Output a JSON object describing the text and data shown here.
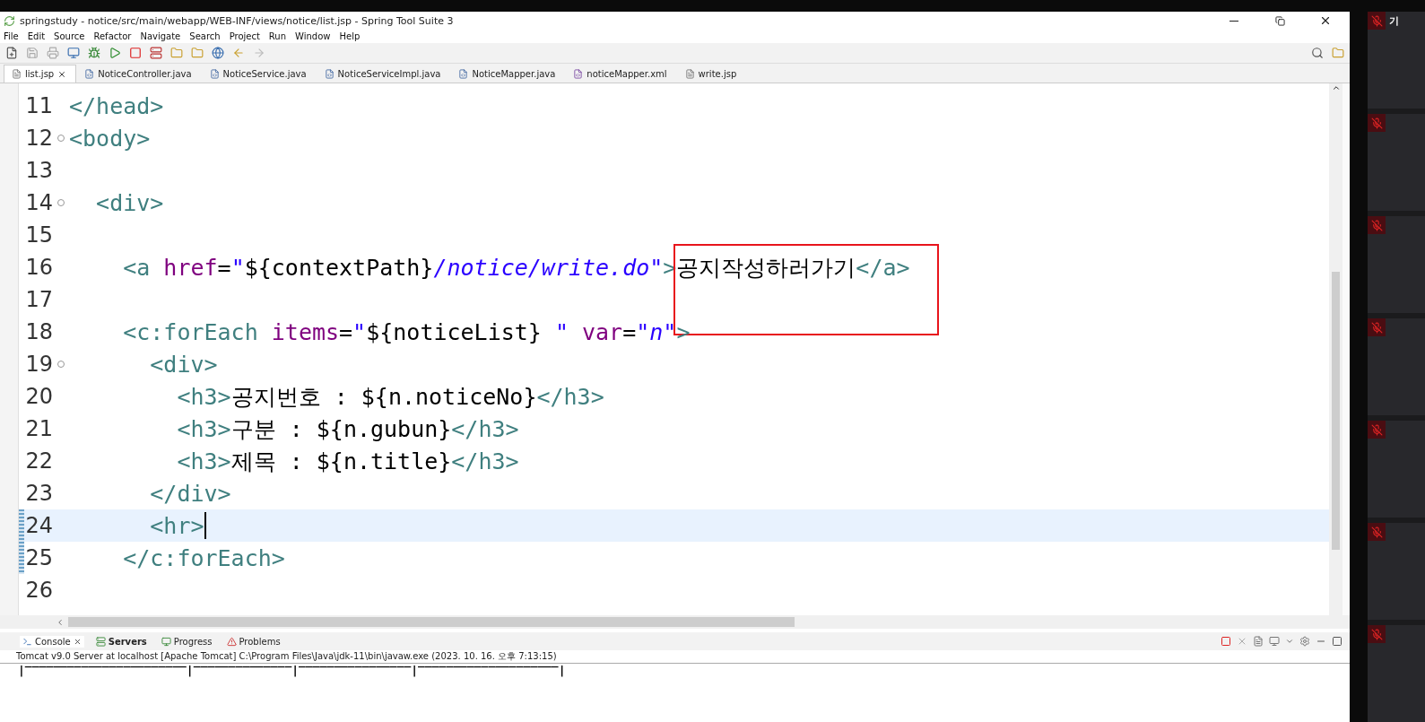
{
  "window": {
    "title": "springstudy - notice/src/main/webapp/WEB-INF/views/notice/list.jsp - Spring Tool Suite 3"
  },
  "menu": [
    "File",
    "Edit",
    "Source",
    "Refactor",
    "Navigate",
    "Search",
    "Project",
    "Run",
    "Window",
    "Help"
  ],
  "editor_tabs": [
    {
      "label": "list.jsp",
      "selected": true,
      "kind": "jsp"
    },
    {
      "label": "NoticeController.java",
      "selected": false,
      "kind": "java"
    },
    {
      "label": "NoticeService.java",
      "selected": false,
      "kind": "java"
    },
    {
      "label": "NoticeServiceImpl.java",
      "selected": false,
      "kind": "java"
    },
    {
      "label": "NoticeMapper.java",
      "selected": false,
      "kind": "java"
    },
    {
      "label": "noticeMapper.xml",
      "selected": false,
      "kind": "xml"
    },
    {
      "label": "write.jsp",
      "selected": false,
      "kind": "jsp"
    }
  ],
  "code_lines": [
    {
      "number": "11",
      "fold": false,
      "current": false,
      "changed": false,
      "tokens": [
        {
          "kind": "tag",
          "text": "</head>"
        }
      ]
    },
    {
      "number": "12",
      "fold": true,
      "current": false,
      "changed": false,
      "tokens": [
        {
          "kind": "tag",
          "text": "<body>"
        }
      ]
    },
    {
      "number": "13",
      "fold": false,
      "current": false,
      "changed": false
    },
    {
      "number": "14",
      "fold": true,
      "current": false,
      "changed": false,
      "tokens": [
        {
          "kind": "tag",
          "text": "  <div>"
        }
      ]
    },
    {
      "number": "15",
      "fold": false,
      "current": false,
      "changed": false
    },
    {
      "number": "16",
      "fold": false,
      "current": false,
      "changed": false,
      "tokens": [
        {
          "kind": "tag",
          "text": "    <a "
        },
        {
          "kind": "attr",
          "text": "href"
        },
        {
          "kind": "plain",
          "text": "="
        },
        {
          "kind": "string",
          "text": "\""
        },
        {
          "kind": "plain",
          "text": "${contextPath}"
        },
        {
          "kind": "string",
          "text": "/notice/write.do\""
        },
        {
          "kind": "tag",
          "text": ">"
        },
        {
          "kind": "boxed",
          "text": "공지작성하러가기"
        },
        {
          "kind": "tag",
          "text": "</a>"
        }
      ]
    },
    {
      "number": "17",
      "fold": false,
      "current": false,
      "changed": false
    },
    {
      "number": "18",
      "fold": false,
      "current": false,
      "changed": false,
      "tokens": [
        {
          "kind": "tag",
          "text": "    <c:forEach "
        },
        {
          "kind": "attr",
          "text": "items"
        },
        {
          "kind": "plain",
          "text": "="
        },
        {
          "kind": "string",
          "text": "\""
        },
        {
          "kind": "plain",
          "text": "${noticeList}"
        },
        {
          "kind": "string",
          "text": " \""
        },
        {
          "kind": "attr",
          "text": " var"
        },
        {
          "kind": "plain",
          "text": "="
        },
        {
          "kind": "string",
          "text": "\"n\""
        },
        {
          "kind": "tag",
          "text": ">"
        }
      ]
    },
    {
      "number": "19",
      "fold": true,
      "current": false,
      "changed": false,
      "tokens": [
        {
          "kind": "tag",
          "text": "      <div>"
        }
      ]
    },
    {
      "number": "20",
      "fold": false,
      "current": false,
      "changed": false,
      "tokens": [
        {
          "kind": "tag",
          "text": "        <h3>"
        },
        {
          "kind": "plain",
          "text": "공지번호 : ${n.noticeNo}"
        },
        {
          "kind": "tag",
          "text": "</h3>"
        }
      ]
    },
    {
      "number": "21",
      "fold": false,
      "current": false,
      "changed": false,
      "tokens": [
        {
          "kind": "tag",
          "text": "        <h3>"
        },
        {
          "kind": "plain",
          "text": "구분 : ${n.gubun}"
        },
        {
          "kind": "tag",
          "text": "</h3>"
        }
      ]
    },
    {
      "number": "22",
      "fold": false,
      "current": false,
      "changed": false,
      "tokens": [
        {
          "kind": "tag",
          "text": "        <h3>"
        },
        {
          "kind": "plain",
          "text": "제목 : ${n.title}"
        },
        {
          "kind": "tag",
          "text": "</h3>"
        }
      ]
    },
    {
      "number": "23",
      "fold": false,
      "current": false,
      "changed": false,
      "tokens": [
        {
          "kind": "tag",
          "text": "      </div>"
        }
      ]
    },
    {
      "number": "24",
      "fold": false,
      "current": true,
      "changed": true,
      "tokens": [
        {
          "kind": "tag",
          "text": "      <hr>"
        }
      ]
    },
    {
      "number": "25",
      "fold": false,
      "current": false,
      "changed": true,
      "tokens": [
        {
          "kind": "tag",
          "text": "    </c:forEach>"
        }
      ]
    },
    {
      "number": "26",
      "fold": false,
      "current": false,
      "changed": false
    }
  ],
  "console": {
    "tabs": [
      {
        "label": "Console",
        "selected": true,
        "bold": false
      },
      {
        "label": "Servers",
        "selected": false,
        "bold": true
      },
      {
        "label": "Progress",
        "selected": false,
        "bold": false
      },
      {
        "label": "Problems",
        "selected": false,
        "bold": false
      }
    ],
    "header": "Tomcat v9.0 Server at localhost [Apache Tomcat] C:\\Program Files\\Java\\jdk-11\\bin\\javaw.exe  (2023. 10. 16. 오후 7:13:15)",
    "output": "|‾‾‾‾‾‾‾‾‾‾‾‾‾‾‾‾‾‾‾‾‾‾‾|‾‾‾‾‾‾‾‾‾‾‾‾‾‾|‾‾‾‾‾‾‾‾‾‾‾‾‾‾‾‾|‾‾‾‾‾‾‾‾‾‾‾‾‾‾‾‾‾‾‾‾|"
  },
  "participants": [
    {
      "name": "기",
      "muted": true
    },
    {
      "muted": true
    },
    {
      "muted": true
    },
    {
      "muted": true
    },
    {
      "muted": true
    },
    {
      "muted": true
    },
    {
      "muted": true
    }
  ]
}
